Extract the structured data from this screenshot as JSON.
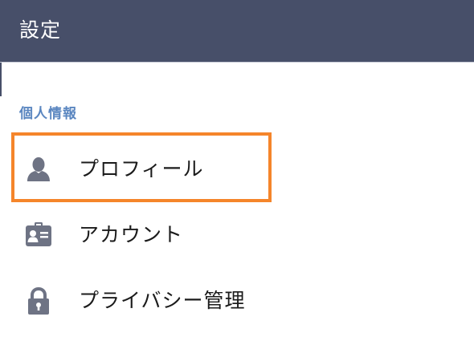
{
  "header": {
    "title": "設定"
  },
  "section": {
    "title": "個人情報"
  },
  "items": [
    {
      "label": "プロフィール",
      "icon": "person-icon"
    },
    {
      "label": "アカウント",
      "icon": "id-card-icon"
    },
    {
      "label": "プライバシー管理",
      "icon": "lock-icon"
    }
  ],
  "colors": {
    "header_bg": "#474f69",
    "section_text": "#5a86c0",
    "icon": "#6e7384",
    "highlight": "#f5852b"
  }
}
